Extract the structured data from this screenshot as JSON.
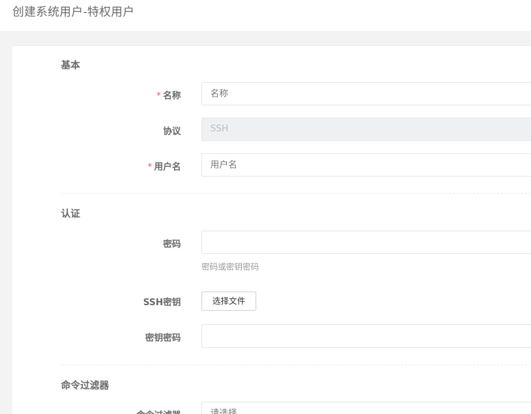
{
  "header": {
    "title": "创建系统用户-特权用户"
  },
  "sections": {
    "basic": "基本",
    "auth": "认证",
    "cmd": "命令过滤器"
  },
  "fields": {
    "name": {
      "label": "名称",
      "placeholder": "名称",
      "required": "*"
    },
    "protocol": {
      "label": "协议",
      "value": "SSH"
    },
    "username": {
      "label": "用户名",
      "placeholder": "用户名",
      "required": "*"
    },
    "password": {
      "label": "密码",
      "help": "密码或密钥密码"
    },
    "ssh_key": {
      "label": "SSH密钥",
      "button": "选择文件"
    },
    "key_password": {
      "label": "密钥密码"
    },
    "cmd_filters": {
      "label": "命令过滤器",
      "placeholder": "请选择"
    }
  }
}
